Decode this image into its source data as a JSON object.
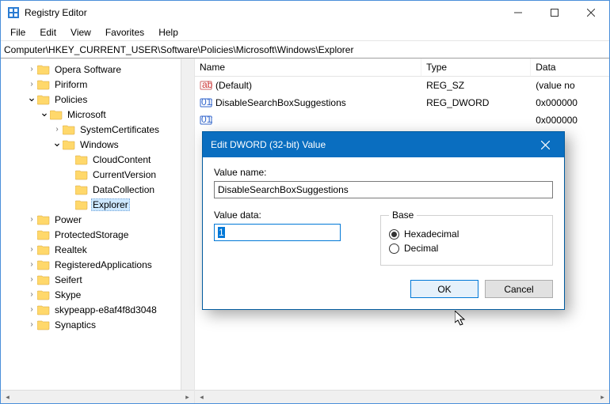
{
  "window": {
    "title": "Registry Editor"
  },
  "menu": [
    "File",
    "Edit",
    "View",
    "Favorites",
    "Help"
  ],
  "address": "Computer\\HKEY_CURRENT_USER\\Software\\Policies\\Microsoft\\Windows\\Explorer",
  "tree": {
    "items": [
      {
        "indent": 2,
        "caret": ">",
        "label": "Opera Software"
      },
      {
        "indent": 2,
        "caret": ">",
        "label": "Piriform"
      },
      {
        "indent": 2,
        "caret": "v",
        "label": "Policies"
      },
      {
        "indent": 3,
        "caret": "v",
        "label": "Microsoft"
      },
      {
        "indent": 4,
        "caret": ">",
        "label": "SystemCertificates"
      },
      {
        "indent": 4,
        "caret": "v",
        "label": "Windows"
      },
      {
        "indent": 5,
        "caret": "",
        "label": "CloudContent"
      },
      {
        "indent": 5,
        "caret": "",
        "label": "CurrentVersion"
      },
      {
        "indent": 5,
        "caret": "",
        "label": "DataCollection"
      },
      {
        "indent": 5,
        "caret": "",
        "label": "Explorer",
        "selected": true
      },
      {
        "indent": 2,
        "caret": ">",
        "label": "Power"
      },
      {
        "indent": 2,
        "caret": "",
        "label": "ProtectedStorage"
      },
      {
        "indent": 2,
        "caret": ">",
        "label": "Realtek"
      },
      {
        "indent": 2,
        "caret": ">",
        "label": "RegisteredApplications"
      },
      {
        "indent": 2,
        "caret": ">",
        "label": "Seifert"
      },
      {
        "indent": 2,
        "caret": ">",
        "label": "Skype"
      },
      {
        "indent": 2,
        "caret": ">",
        "label": "skypeapp-e8af4f8d3048"
      },
      {
        "indent": 2,
        "caret": ">",
        "label": "Synaptics"
      }
    ]
  },
  "list": {
    "columns": {
      "name": "Name",
      "type": "Type",
      "data": "Data"
    },
    "rows": [
      {
        "icon": "sz",
        "name": "(Default)",
        "type": "REG_SZ",
        "data": "(value no"
      },
      {
        "icon": "dword",
        "name": "DisableSearchBoxSuggestions",
        "type": "REG_DWORD",
        "data": "0x000000"
      },
      {
        "icon": "dword",
        "name": "",
        "type": "",
        "data": "0x000000"
      }
    ]
  },
  "dialog": {
    "title": "Edit DWORD (32-bit) Value",
    "value_name_label": "Value name:",
    "value_name": "DisableSearchBoxSuggestions",
    "value_data_label": "Value data:",
    "value_data": "1",
    "base_legend": "Base",
    "hex": "Hexadecimal",
    "dec": "Decimal",
    "ok": "OK",
    "cancel": "Cancel"
  }
}
